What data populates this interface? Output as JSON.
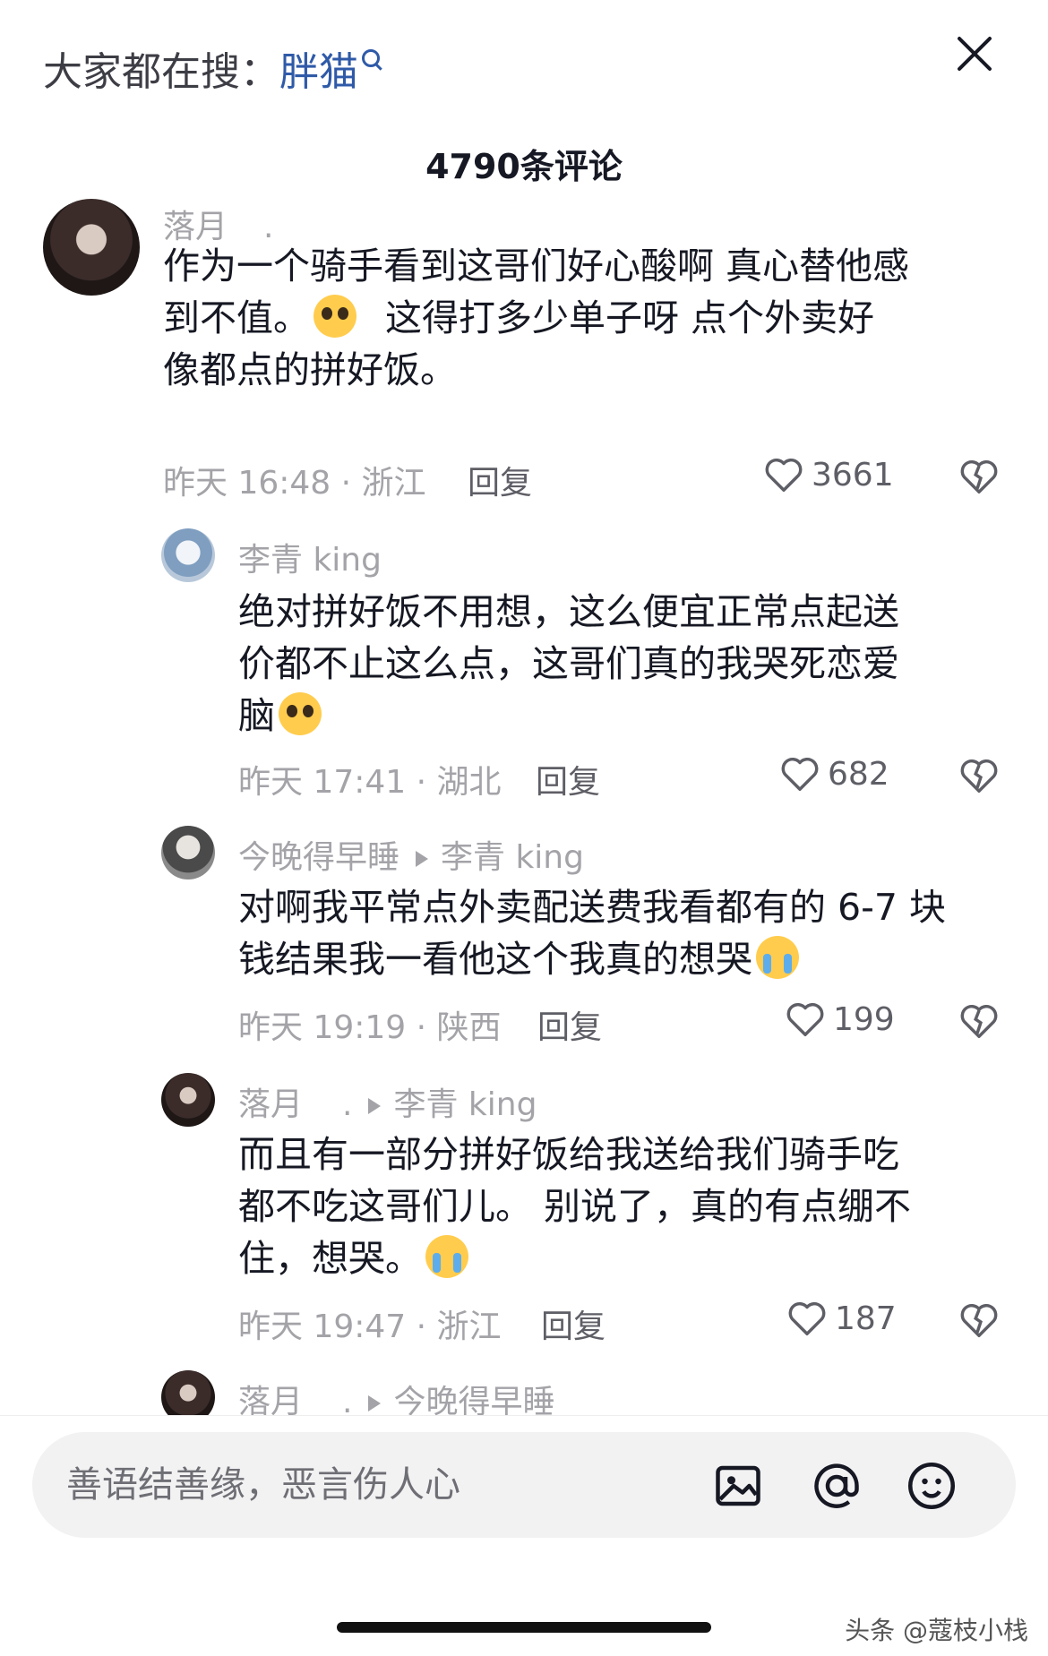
{
  "header": {
    "search_prefix": "大家都在搜：",
    "search_keyword": "胖猫",
    "comment_count": "4790条评论"
  },
  "comments": [
    {
      "author": "落月",
      "author_suffix": ".",
      "text_lines": [
        "作为一个骑手看到这哥们好心酸啊  真心替他感",
        "到不值。",
        "这得打多少单子呀    点个外卖好",
        "像都点的拼好饭。"
      ],
      "time_location": "昨天 16:48 · 浙江",
      "reply_label": "回复",
      "likes": "3661"
    },
    {
      "author": "李青 king",
      "text_lines": [
        "绝对拼好饭不用想，这么便宜正常点起送",
        "价都不止这么点，这哥们真的我哭死恋爱",
        "脑"
      ],
      "time_location": "昨天 17:41 · 湖北",
      "reply_label": "回复",
      "likes": "682"
    },
    {
      "author": "今晚得早睡",
      "reply_to": "李青 king",
      "text_lines": [
        "对啊我平常点外卖配送费我看都有的 6-7 块",
        "钱结果我一看他这个我真的想哭"
      ],
      "time_location": "昨天 19:19 · 陕西",
      "reply_label": "回复",
      "likes": "199"
    },
    {
      "author": "落月",
      "author_suffix": ".",
      "reply_to": "李青 king",
      "text_lines": [
        "而且有一部分拼好饭给我送给我们骑手吃",
        "都不吃这哥们儿。 别说了，真的有点绷不",
        "住，想哭。"
      ],
      "time_location": "昨天 19:47 · 浙江",
      "reply_label": "回复",
      "likes": "187"
    },
    {
      "author": "落月",
      "author_suffix": ".",
      "reply_to": "今晚得早睡"
    }
  ],
  "input": {
    "placeholder": "善语结善缘，恶言伤人心"
  },
  "icons": [
    "search-icon",
    "close-icon",
    "heart-icon",
    "dislike-icon",
    "image-icon",
    "mention-icon",
    "emoji-icon"
  ],
  "watermark": "头条 @蔻枝小栈",
  "colors": {
    "keyword": "#2f5aa8",
    "meta": "#a3a3a8",
    "text": "#161823"
  }
}
